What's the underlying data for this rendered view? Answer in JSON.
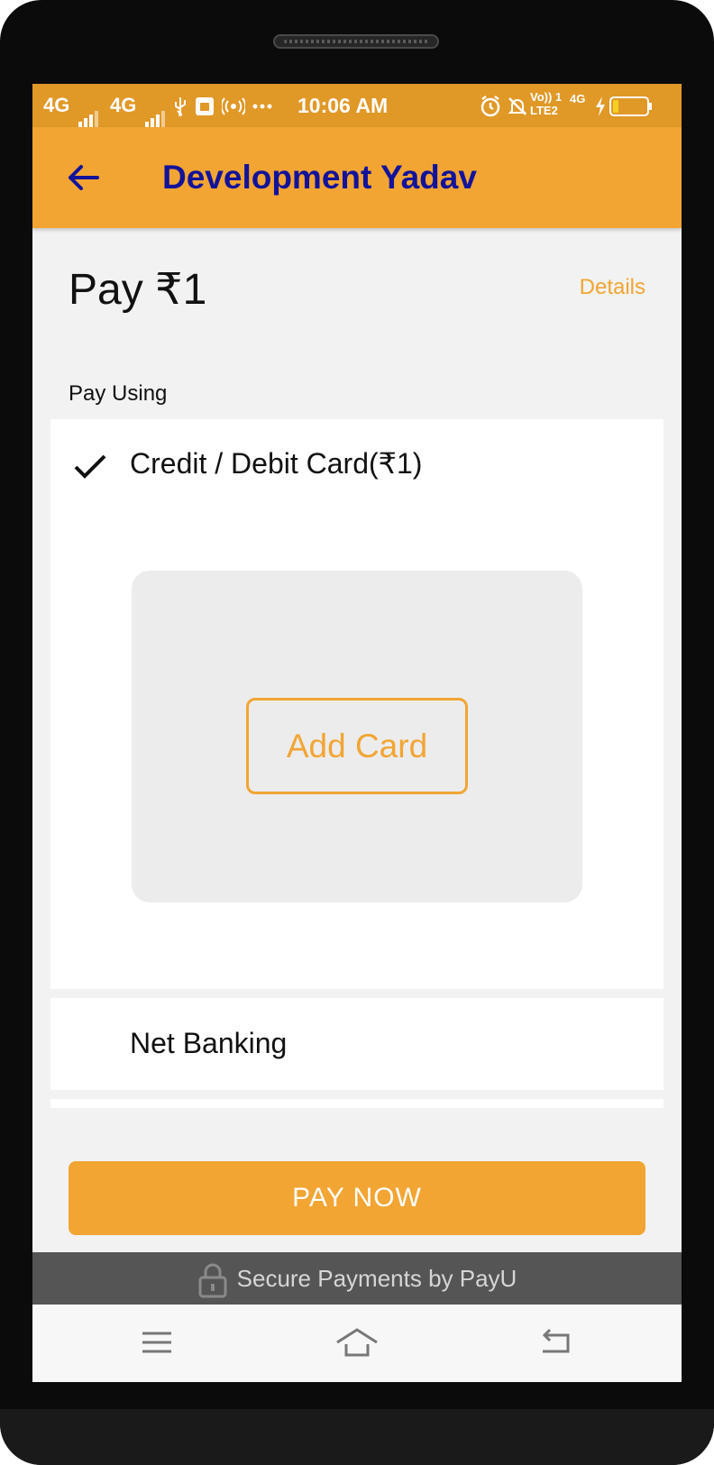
{
  "status_bar": {
    "signal_1": "4G",
    "signal_2": "4G",
    "time": "10:06 AM",
    "volte": "Vo)) 1",
    "lte": "LTE2",
    "network": "4G",
    "icons": [
      "usb-icon",
      "sim-icon",
      "hotspot-icon",
      "more-dots-icon",
      "alarm-icon",
      "notifications-off-icon",
      "charging-icon",
      "battery-icon"
    ]
  },
  "app_bar": {
    "title": "Development Yadav",
    "back_icon": "back-arrow-icon"
  },
  "payment": {
    "amount_label": "Pay ₹1",
    "details_link": "Details",
    "pay_using_label": "Pay Using"
  },
  "methods": {
    "card": {
      "label": "Credit / Debit Card(₹1)",
      "selected": true,
      "add_card_label": "Add Card"
    },
    "net_banking": {
      "label": "Net Banking"
    }
  },
  "pay_now_label": "PAY NOW",
  "footer": {
    "secure_label": "Secure Payments by PayU"
  },
  "nav_bar": {
    "icons": [
      "menu-icon",
      "home-icon",
      "back-icon"
    ]
  },
  "colors": {
    "accent": "#f2a533",
    "status_bar": "#e09827",
    "title": "#12139a",
    "footer_bg": "#555555",
    "page_bg": "#f2f2f2"
  }
}
